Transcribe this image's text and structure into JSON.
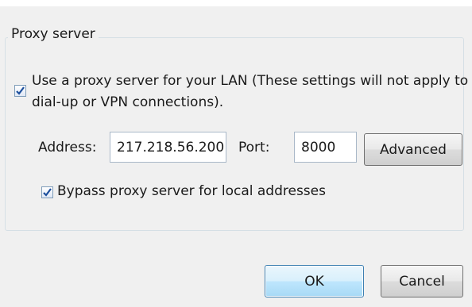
{
  "proxy": {
    "group_title": "Proxy server",
    "use_proxy_label": "Use a proxy server for your LAN (These settings will not apply to",
    "use_proxy_label_line2": "dial-up or VPN connections).",
    "use_proxy_checked": true,
    "address_label": "Address:",
    "address_value": "217.218.56.200",
    "port_label": "Port:",
    "port_value": "8000",
    "advanced_label": "Advanced",
    "bypass_label": "Bypass proxy server for local addresses",
    "bypass_checked": true
  },
  "footer": {
    "ok_label": "OK",
    "cancel_label": "Cancel"
  },
  "colors": {
    "checkmark": "#1c4e9c",
    "default_button_border": "#3c7fb1"
  }
}
